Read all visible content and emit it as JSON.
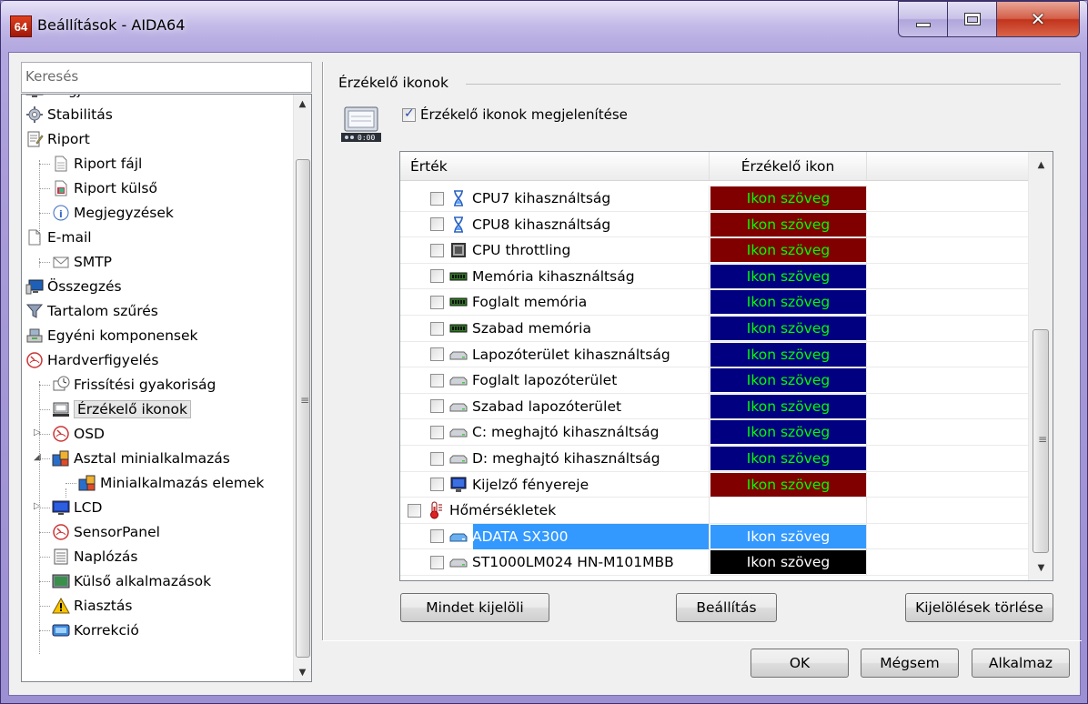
{
  "window": {
    "title": "Beállítások - AIDA64",
    "icon_text": "64",
    "close_glyph": "✕"
  },
  "search": {
    "placeholder": "Keresés"
  },
  "tree": [
    {
      "label": "Megjelenés",
      "icon": "monitor-icon"
    },
    {
      "label": "Stabilitás",
      "icon": "gear-icon"
    },
    {
      "label": "Riport",
      "icon": "report-icon"
    },
    {
      "label": "Riport fájl",
      "icon": "file-icon"
    },
    {
      "label": "Riport külső",
      "icon": "report-external-icon"
    },
    {
      "label": "Megjegyzések",
      "icon": "info-icon"
    },
    {
      "label": "E-mail",
      "icon": "email-icon"
    },
    {
      "label": "SMTP",
      "icon": "smtp-icon"
    },
    {
      "label": "Összegzés",
      "icon": "summary-icon"
    },
    {
      "label": "Tartalom szűrés",
      "icon": "filter-icon"
    },
    {
      "label": "Egyéni komponensek",
      "icon": "components-icon"
    },
    {
      "label": "Hardverfigyelés",
      "icon": "gauge-icon"
    },
    {
      "label": "Frissítési gyakoriság",
      "icon": "clock-icon"
    },
    {
      "label": "Érzékelő ikonok",
      "icon": "sensor-icon"
    },
    {
      "label": "OSD",
      "icon": "gauge-icon"
    },
    {
      "label": "Asztal minialkalmazás",
      "icon": "gadget-icon"
    },
    {
      "label": "Minialkalmazás elemek",
      "icon": "gadget-icon"
    },
    {
      "label": "LCD",
      "icon": "lcd-icon"
    },
    {
      "label": "SensorPanel",
      "icon": "gauge-icon"
    },
    {
      "label": "Naplózás",
      "icon": "log-icon"
    },
    {
      "label": "Külső alkalmazások",
      "icon": "external-app-icon"
    },
    {
      "label": "Riasztás",
      "icon": "warning-icon"
    },
    {
      "label": "Korrekció",
      "icon": "correction-icon"
    }
  ],
  "panel": {
    "group_title": "Érzékelő ikonok",
    "show_checkbox_label": "Érzékelő ikonok megjelenítése",
    "show_checkbox_checked": true,
    "columns": [
      "Érték",
      "Érzékelő ikon"
    ],
    "rows": [
      {
        "label": "CPU7 kihasználtság",
        "icon": "hourglass-icon",
        "value": "Ikon szöveg",
        "bg": "#800000",
        "fg": "#00ff00",
        "checked": false
      },
      {
        "label": "CPU8 kihasználtság",
        "icon": "hourglass-icon",
        "value": "Ikon szöveg",
        "bg": "#800000",
        "fg": "#00ff00",
        "checked": false
      },
      {
        "label": "CPU throttling",
        "icon": "cpu-icon",
        "value": "Ikon szöveg",
        "bg": "#800000",
        "fg": "#00ff00",
        "checked": false
      },
      {
        "label": "Memória kihasználtság",
        "icon": "memory-icon",
        "value": "Ikon szöveg",
        "bg": "#000080",
        "fg": "#00ff00",
        "checked": false
      },
      {
        "label": "Foglalt memória",
        "icon": "memory-icon",
        "value": "Ikon szöveg",
        "bg": "#000080",
        "fg": "#00ff00",
        "checked": false
      },
      {
        "label": "Szabad memória",
        "icon": "memory-icon",
        "value": "Ikon szöveg",
        "bg": "#000080",
        "fg": "#00ff00",
        "checked": false
      },
      {
        "label": "Lapozóterület kihasználtság",
        "icon": "drive-icon",
        "value": "Ikon szöveg",
        "bg": "#000080",
        "fg": "#00ff00",
        "checked": false
      },
      {
        "label": "Foglalt lapozóterület",
        "icon": "drive-icon",
        "value": "Ikon szöveg",
        "bg": "#000080",
        "fg": "#00ff00",
        "checked": false
      },
      {
        "label": "Szabad lapozóterület",
        "icon": "drive-icon",
        "value": "Ikon szöveg",
        "bg": "#000080",
        "fg": "#00ff00",
        "checked": false
      },
      {
        "label": "C: meghajtó kihasználtság",
        "icon": "drive-icon",
        "value": "Ikon szöveg",
        "bg": "#000080",
        "fg": "#00ff00",
        "checked": false
      },
      {
        "label": "D: meghajtó kihasználtság",
        "icon": "drive-icon",
        "value": "Ikon szöveg",
        "bg": "#000080",
        "fg": "#00ff00",
        "checked": false
      },
      {
        "label": "Kijelző fényereje",
        "icon": "display-icon",
        "value": "Ikon szöveg",
        "bg": "#800000",
        "fg": "#00ff00",
        "checked": false
      },
      {
        "label": "Hőmérsékletek",
        "icon": "thermometer-icon",
        "value": "",
        "bg": "",
        "fg": "",
        "checked": false,
        "group": true
      },
      {
        "label": "ADATA SX300",
        "icon": "ssd-icon",
        "value": "Ikon szöveg",
        "bg": "#3399ff",
        "fg": "#ffffff",
        "checked": false,
        "selected": true
      },
      {
        "label": "ST1000LM024 HN-M101MBB",
        "icon": "drive-icon",
        "value": "Ikon szöveg",
        "bg": "#000000",
        "fg": "#ffffff",
        "checked": false
      }
    ],
    "buttons": {
      "select_all": "Mindet kijelöli",
      "settings": "Beállítás",
      "clear_selection": "Kijelölések törlése"
    }
  },
  "footer": {
    "ok": "OK",
    "cancel": "Mégsem",
    "apply": "Alkalmaz"
  }
}
